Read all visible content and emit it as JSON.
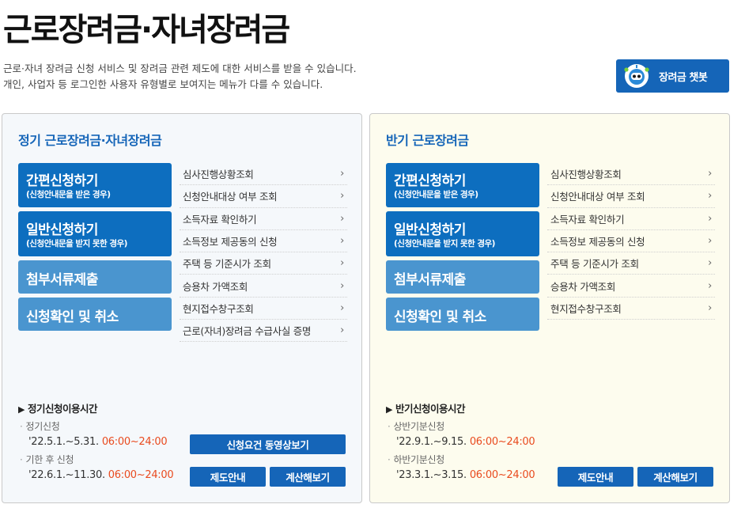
{
  "page": {
    "title": "근로장려금·자녀장려금",
    "desc_line1": "근로·자녀 장려금 신청 서비스 및 장려금 관련 제도에 대한 서비스를 받을 수 있습니다.",
    "desc_line2": "개인, 사업자 등 로그인한 사용자 유형별로 보여지는 메뉴가 다를 수 있습니다."
  },
  "chatbot": {
    "label": "장려금 챗봇",
    "icon": "robot-icon"
  },
  "regular": {
    "title": "정기 근로장려금·자녀장려금",
    "buttons": [
      {
        "main": "간편신청하기",
        "sub": "(신청안내문을 받은 경우)"
      },
      {
        "main": "일반신청하기",
        "sub": "(신청안내문을 받지 못한 경우)"
      },
      {
        "main": "첨부서류제출",
        "sub": ""
      },
      {
        "main": "신청확인 및 취소",
        "sub": ""
      }
    ],
    "menu": [
      "심사진행상황조회",
      "신청안내대상 여부 조회",
      "소득자료 확인하기",
      "소득정보 제공동의 신청",
      "주택 등 기준시가 조회",
      "승용차 가액조회",
      "현지접수창구조회",
      "근로(자녀)장려금 수급사실 증명"
    ],
    "hours_title": "정기신청이용시간",
    "hours": [
      {
        "label": "정기신청",
        "dates": "'22.5.1.~5.31.",
        "time": "06:00~24:00"
      },
      {
        "label": "기한 후 신청",
        "dates": "'22.6.1.~11.30.",
        "time": "06:00~24:00"
      }
    ],
    "video_btn": "신청요건 동영상보기",
    "guide_btn": "제도안내",
    "calc_btn": "계산해보기"
  },
  "half": {
    "title": "반기 근로장려금",
    "buttons": [
      {
        "main": "간편신청하기",
        "sub": "(신청안내문을 받은 경우)"
      },
      {
        "main": "일반신청하기",
        "sub": "(신청안내문을 받지 못한 경우)"
      },
      {
        "main": "첨부서류제출",
        "sub": ""
      },
      {
        "main": "신청확인 및 취소",
        "sub": ""
      }
    ],
    "menu": [
      "심사진행상황조회",
      "신청안내대상 여부 조회",
      "소득자료 확인하기",
      "소득정보 제공동의 신청",
      "주택 등 기준시가 조회",
      "승용차 가액조회",
      "현지접수창구조회"
    ],
    "hours_title": "반기신청이용시간",
    "hours": [
      {
        "label": "상반기분신청",
        "dates": "'22.9.1.~9.15.",
        "time": "06:00~24:00"
      },
      {
        "label": "하반기분신청",
        "dates": "'23.3.1.~3.15.",
        "time": "06:00~24:00"
      }
    ],
    "guide_btn": "제도안내",
    "calc_btn": "계산해보기"
  },
  "colors": {
    "accent": "#1565b8",
    "button_dark": "#0d6ebf",
    "button_light": "#4a95cf",
    "time": "#e94b1f",
    "half_bg": "#fdfcee",
    "regular_bg": "#f5f8fb"
  }
}
